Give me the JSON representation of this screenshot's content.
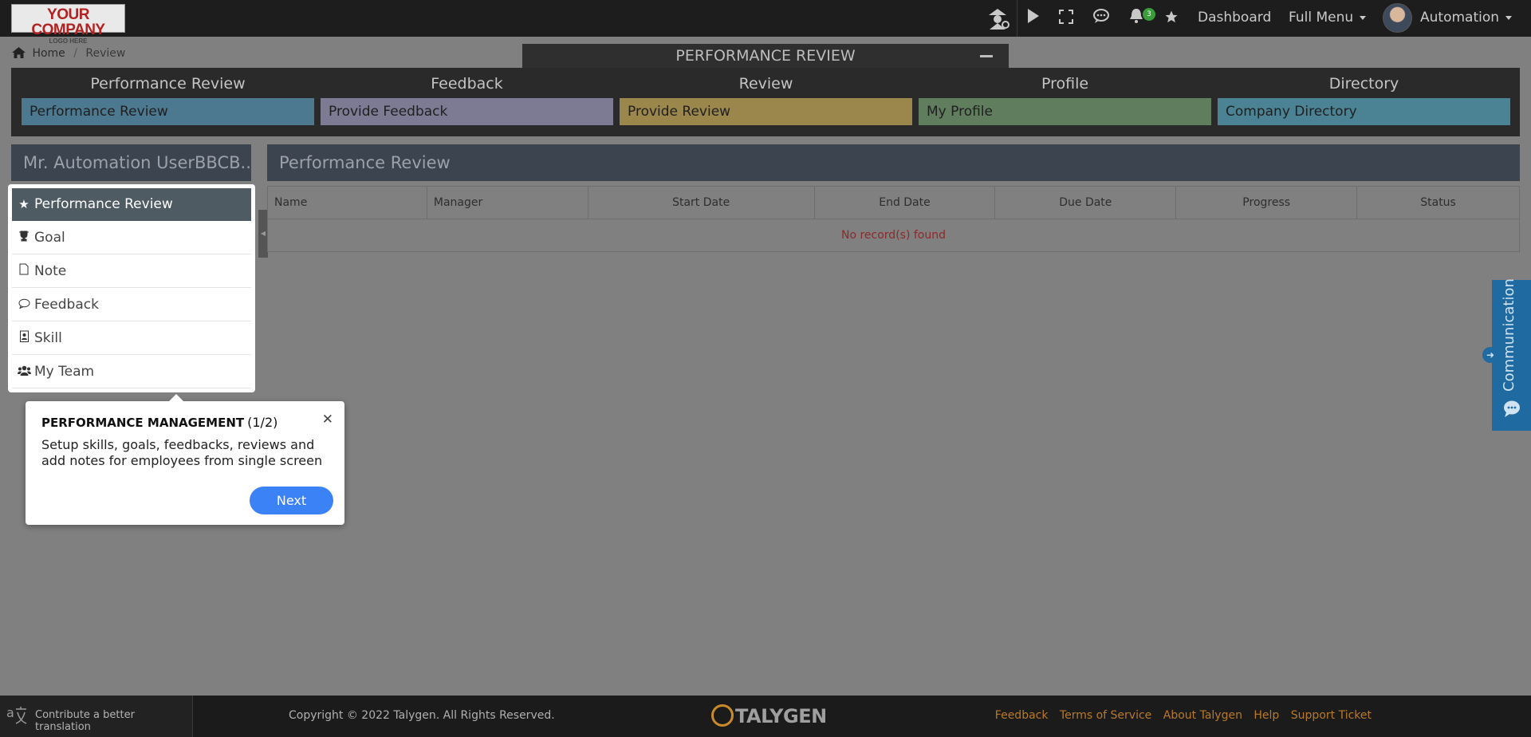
{
  "header": {
    "logo_line1": "YOUR COMPANY",
    "logo_line2": "LOGO HERE",
    "notification_count": "3",
    "dashboard_label": "Dashboard",
    "full_menu_label": "Full Menu",
    "user_label": "Automation"
  },
  "breadcrumb": {
    "home": "Home",
    "separator": "/",
    "current": "Review"
  },
  "page_title": "PERFORMANCE REVIEW",
  "modules": [
    {
      "title": "Performance Review",
      "link": "Performance Review",
      "color": "#4c7890"
    },
    {
      "title": "Feedback",
      "link": "Provide Feedback",
      "color": "#7d7a94"
    },
    {
      "title": "Review",
      "link": "Provide Review",
      "color": "#9b874c"
    },
    {
      "title": "Profile",
      "link": "My Profile",
      "color": "#607d5e"
    },
    {
      "title": "Directory",
      "link": "Company Directory",
      "color": "#4c8394"
    }
  ],
  "sidebar": {
    "user_name": "Mr. Automation UserBBCB...",
    "items": [
      {
        "label": "Performance Review",
        "icon": "star-icon"
      },
      {
        "label": "Goal",
        "icon": "trophy-icon"
      },
      {
        "label": "Note",
        "icon": "file-icon"
      },
      {
        "label": "Feedback",
        "icon": "comment-icon"
      },
      {
        "label": "Skill",
        "icon": "badge-icon"
      },
      {
        "label": "My Team",
        "icon": "users-icon"
      }
    ]
  },
  "main": {
    "title": "Performance Review",
    "columns": [
      "Name",
      "Manager",
      "Start Date",
      "End Date",
      "Due Date",
      "Progress",
      "Status"
    ],
    "empty_message": "No record(s) found"
  },
  "communication_tab": {
    "label": "Communication"
  },
  "tour": {
    "title": "PERFORMANCE MANAGEMENT",
    "step": "(1/2)",
    "body": "Setup skills, goals, feedbacks, reviews and add notes for employees from single screen",
    "next_label": "Next"
  },
  "footer": {
    "translate_label": "Contribute a better translation",
    "copyright": "Copyright © 2022 Talygen. All Rights Reserved.",
    "brand": "TALYGEN",
    "links": [
      "Feedback",
      "Terms of Service",
      "About Talygen",
      "Help",
      "Support Ticket"
    ]
  }
}
